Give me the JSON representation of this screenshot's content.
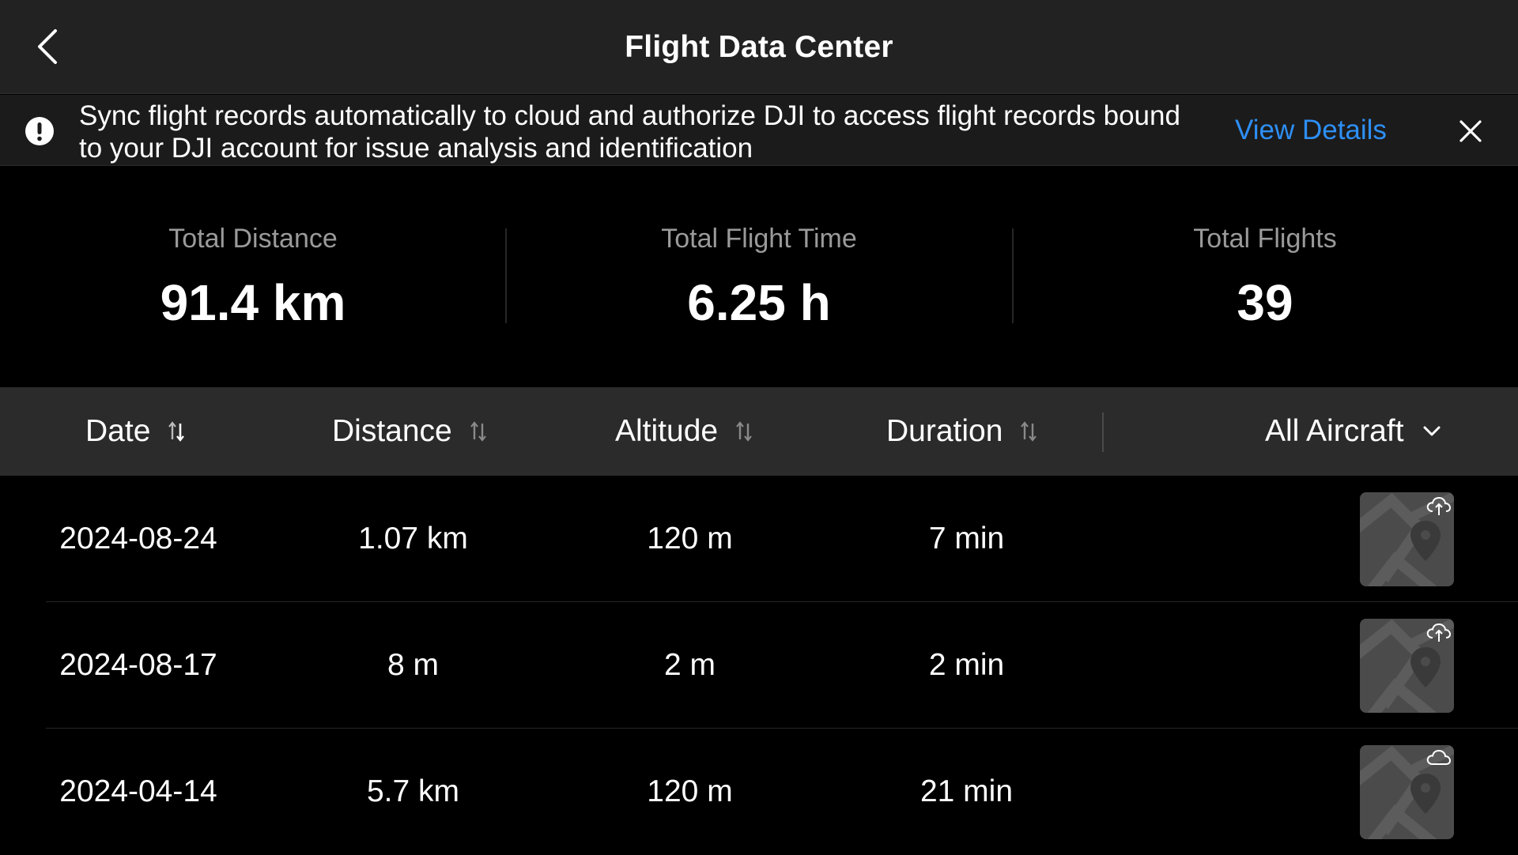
{
  "header": {
    "title": "Flight Data Center",
    "back_icon": "chevron-left-icon"
  },
  "banner": {
    "icon": "warning-icon",
    "text": "Sync flight records automatically to cloud and authorize DJI to access flight records bound to your DJI account for issue analysis and identification",
    "link_label": "View Details",
    "close_icon": "close-icon",
    "link_color": "#2e8ff5"
  },
  "stats": [
    {
      "label": "Total Distance",
      "value": "91.4 km"
    },
    {
      "label": "Total Flight Time",
      "value": "6.25 h"
    },
    {
      "label": "Total Flights",
      "value": "39"
    }
  ],
  "columns": {
    "date": "Date",
    "distance": "Distance",
    "altitude": "Altitude",
    "duration": "Duration",
    "sort_icon": "sort-icon",
    "filter_label": "All Aircraft",
    "filter_icon": "chevron-down-icon"
  },
  "records": [
    {
      "date": "2024-08-24",
      "distance": "1.07 km",
      "altitude": "120 m",
      "duration": "7 min",
      "sync_icon": "cloud-upload-icon"
    },
    {
      "date": "2024-08-17",
      "distance": "8 m",
      "altitude": "2 m",
      "duration": "2 min",
      "sync_icon": "cloud-upload-icon"
    },
    {
      "date": "2024-04-14",
      "distance": "5.7 km",
      "altitude": "120 m",
      "duration": "21 min",
      "sync_icon": "cloud-icon"
    }
  ]
}
